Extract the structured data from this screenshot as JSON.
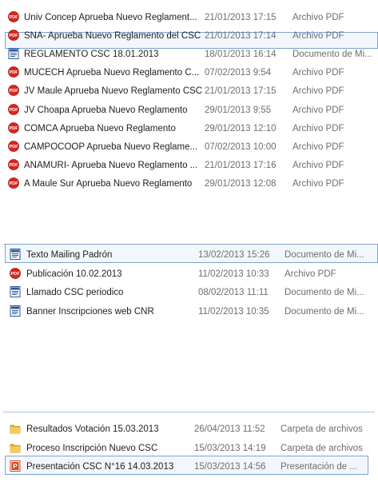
{
  "group1": {
    "rows": [
      {
        "name": "Univ Concep Aprueba Nuevo Reglament...",
        "date": "21/01/2013 17:15",
        "type": "Archivo PDF",
        "icon": "pdf-icon"
      },
      {
        "name": "SNA- Aprueba Nuevo Reglamento del CSC",
        "date": "21/01/2013 17:14",
        "type": "Archivo PDF",
        "icon": "pdf-icon"
      },
      {
        "name": "REGLAMENTO CSC 18.01.2013",
        "date": "18/01/2013 16:14",
        "type": "Documento de Mi...",
        "icon": "word-icon"
      },
      {
        "name": "MUCECH Aprueba Nuevo Reglamento C...",
        "date": "07/02/2013 9:54",
        "type": "Archivo PDF",
        "icon": "pdf-icon"
      },
      {
        "name": "JV Maule Aprueba Nuevo Reglamento CSC",
        "date": "21/01/2013 17:15",
        "type": "Archivo PDF",
        "icon": "pdf-icon"
      },
      {
        "name": "JV Choapa Aprueba Nuevo Reglamento",
        "date": "29/01/2013 9:55",
        "type": "Archivo PDF",
        "icon": "pdf-icon"
      },
      {
        "name": "COMCA Aprueba Nuevo Reglamento",
        "date": "29/01/2013 12:10",
        "type": "Archivo PDF",
        "icon": "pdf-icon"
      },
      {
        "name": "CAMPOCOOP Aprueba Nuevo Reglame...",
        "date": "07/02/2013 10:00",
        "type": "Archivo PDF",
        "icon": "pdf-icon"
      },
      {
        "name": "ANAMURI- Aprueba Nuevo Reglamento ...",
        "date": "21/01/2013 17:16",
        "type": "Archivo PDF",
        "icon": "pdf-icon"
      },
      {
        "name": "A Maule Sur Aprueba Nuevo Reglamento",
        "date": "29/01/2013 12:08",
        "type": "Archivo PDF",
        "icon": "pdf-icon"
      }
    ]
  },
  "group2": {
    "rows": [
      {
        "name": "Texto Mailing Padrón",
        "date": "13/02/2013 15:26",
        "type": "Documento de Mi...",
        "icon": "word-icon"
      },
      {
        "name": "Publicación 10.02.2013",
        "date": "11/02/2013 10:33",
        "type": "Archivo PDF",
        "icon": "pdf-icon"
      },
      {
        "name": "Llamado CSC periodico",
        "date": "08/02/2013 11:11",
        "type": "Documento de Mi...",
        "icon": "word-icon"
      },
      {
        "name": "Banner Inscripciones web CNR",
        "date": "11/02/2013 10:35",
        "type": "Documento de Mi...",
        "icon": "word-icon"
      }
    ]
  },
  "group3": {
    "rows": [
      {
        "name": "Resultados Votación 15.03.2013",
        "date": "26/04/2013 11:52",
        "type": "Carpeta de archivos",
        "icon": "folder-icon"
      },
      {
        "name": "Proceso Inscripción Nuevo CSC",
        "date": "15/03/2013 14:19",
        "type": "Carpeta de archivos",
        "icon": "folder-icon"
      },
      {
        "name": "Presentación CSC N°16 14.03.2013",
        "date": "15/03/2013 14:56",
        "type": "Presentación de ...",
        "icon": "powerpoint-icon"
      }
    ]
  },
  "colors": {
    "selection_border": "#7da2ce",
    "pdf": "#d9261c",
    "word": "#2b5797",
    "folder": "#e8b52e",
    "powerpoint": "#d24726"
  }
}
